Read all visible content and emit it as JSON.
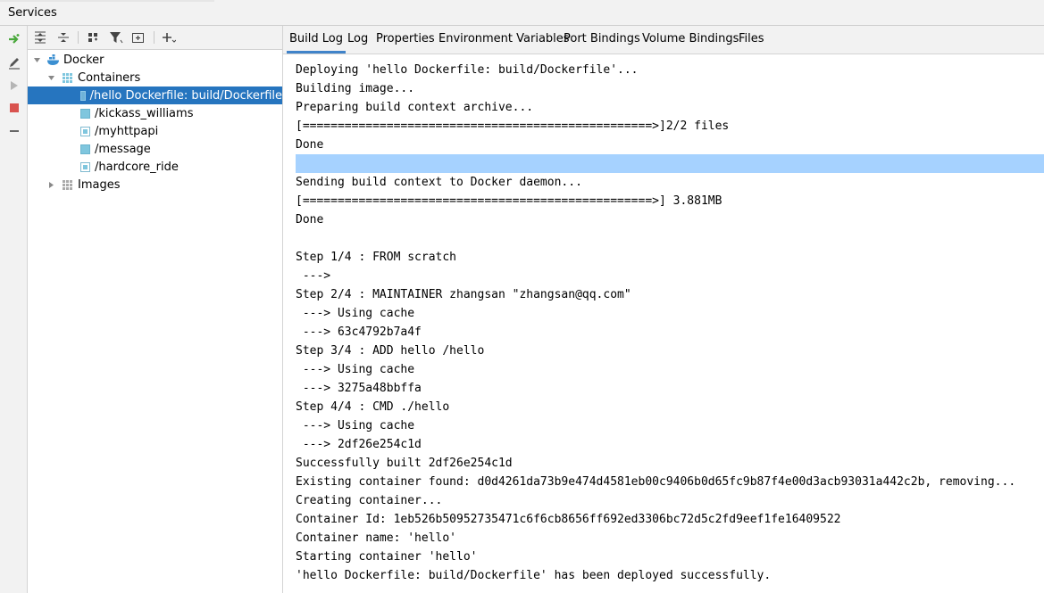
{
  "window": {
    "title": "Services"
  },
  "toolbar": {
    "left_icons": [
      "run-icon",
      "edit-icon",
      "play-icon",
      "stop-icon",
      "minus-icon"
    ],
    "tree_icons": [
      "expand-all-icon",
      "collapse-all-icon",
      "group-icon",
      "filter-icon",
      "new-service-icon",
      "add-icon"
    ]
  },
  "tree": {
    "docker": "Docker",
    "containers": "Containers",
    "items": [
      {
        "label": "/hello Dockerfile: build/Dockerfile",
        "state": "running",
        "selected": true
      },
      {
        "label": "/kickass_williams",
        "state": "running",
        "selected": false
      },
      {
        "label": "/myhttpapi",
        "state": "stopped",
        "selected": false
      },
      {
        "label": "/message",
        "state": "running",
        "selected": false
      },
      {
        "label": "/hardcore_ride",
        "state": "stopped",
        "selected": false
      }
    ],
    "images": "Images"
  },
  "tabs": [
    {
      "label": "Build Log",
      "active": true
    },
    {
      "label": "Log",
      "active": false
    },
    {
      "label": "Properties",
      "active": false
    },
    {
      "label": "Environment Variables",
      "active": false
    },
    {
      "label": "Port Bindings",
      "active": false
    },
    {
      "label": "Volume Bindings",
      "active": false
    },
    {
      "label": "Files",
      "active": false
    }
  ],
  "log": {
    "highlight_line": 5,
    "lines": [
      "Deploying 'hello Dockerfile: build/Dockerfile'...",
      "Building image...",
      "Preparing build context archive...",
      "[==================================================>]2/2 files",
      "Done",
      "",
      "Sending build context to Docker daemon...",
      "[==================================================>] 3.881MB",
      "Done",
      "",
      "Step 1/4 : FROM scratch",
      " --->",
      "Step 2/4 : MAINTAINER zhangsan \"zhangsan@qq.com\"",
      " ---> Using cache",
      " ---> 63c4792b7a4f",
      "Step 3/4 : ADD hello /hello",
      " ---> Using cache",
      " ---> 3275a48bbffa",
      "Step 4/4 : CMD ./hello",
      " ---> Using cache",
      " ---> 2df26e254c1d",
      "Successfully built 2df26e254c1d",
      "Existing container found: d0d4261da73b9e474d4581eb00c9406b0d65fc9b87f4e00d3acb93031a442c2b, removing...",
      "Creating container...",
      "Container Id: 1eb526b50952735471c6f6cb8656ff692ed3306bc72d5c2fd9eef1fe16409522",
      "Container name: 'hello'",
      "Starting container 'hello'",
      "'hello Dockerfile: build/Dockerfile' has been deployed successfully."
    ]
  },
  "colors": {
    "selection": "#2675bf",
    "log_highlight": "#a6d2ff",
    "tab_underline": "#4083c9",
    "run_green": "#4aa83c",
    "stop_red": "#d9534f",
    "container_blue": "#7fc6de",
    "docker_blue": "#3b8fd1"
  }
}
